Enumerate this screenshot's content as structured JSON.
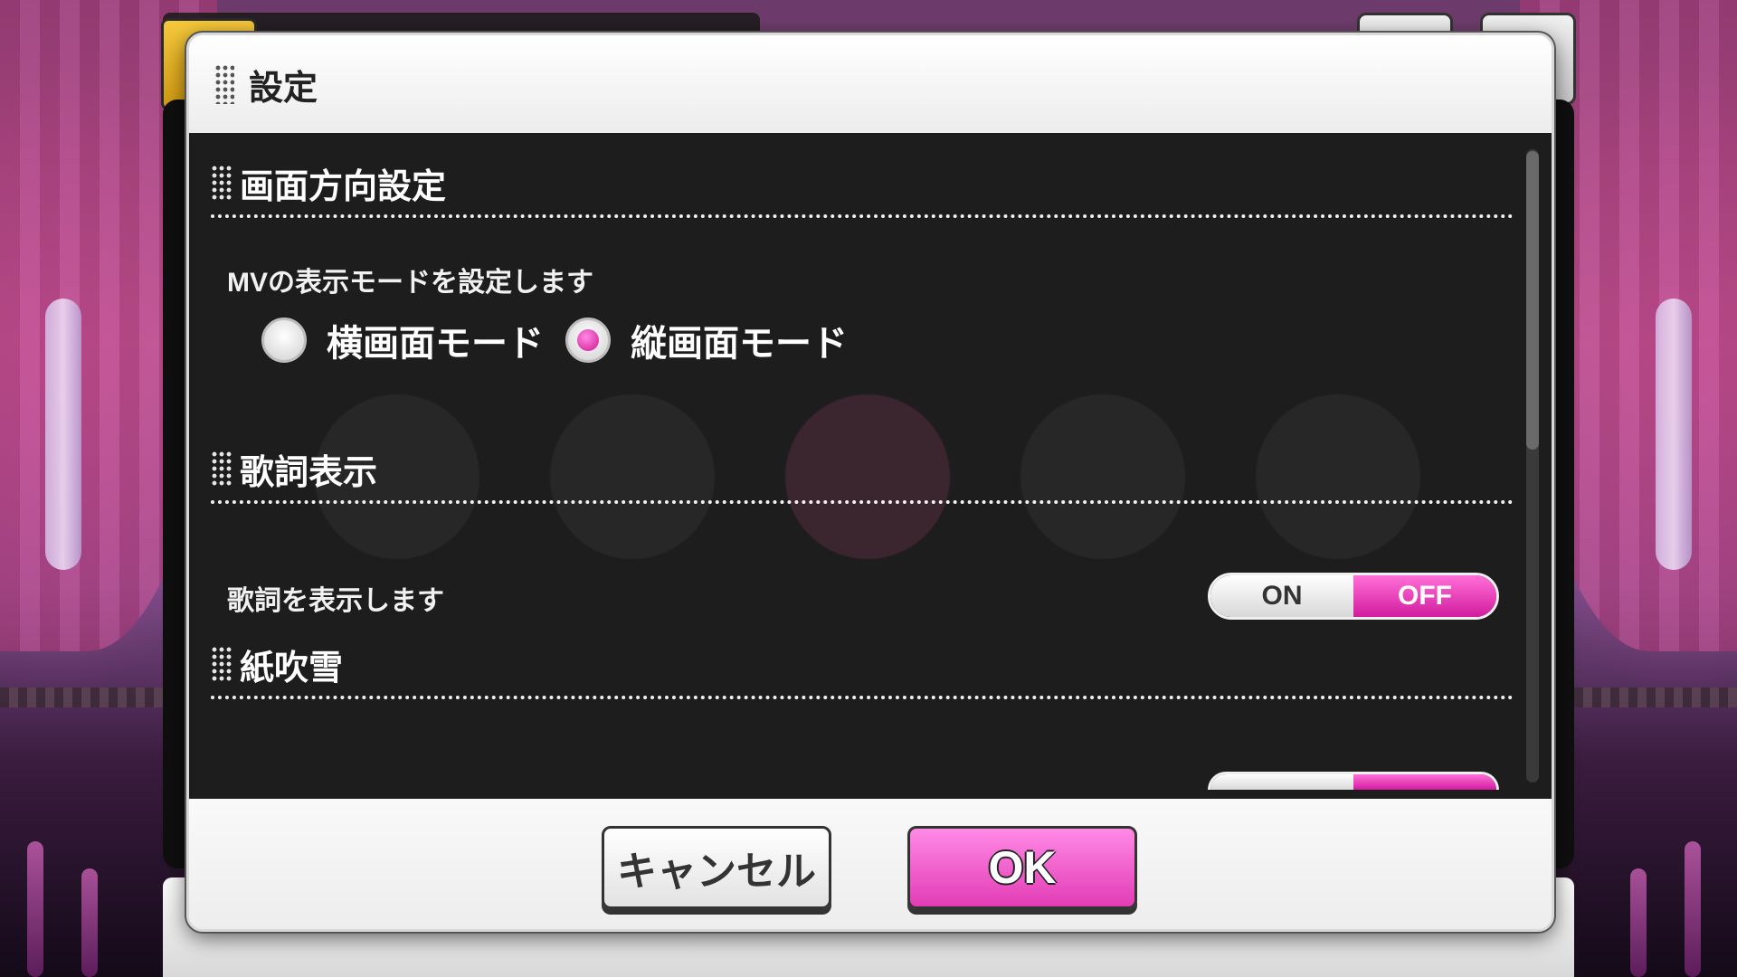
{
  "dialog": {
    "title": "設定"
  },
  "sections": {
    "orientation": {
      "title": "画面方向設定",
      "description": "MVの表示モードを設定します",
      "options": [
        {
          "label": "横画面モード",
          "selected": false
        },
        {
          "label": "縦画面モード",
          "selected": true
        }
      ]
    },
    "lyrics": {
      "title": "歌詞表示",
      "description": "歌詞を表示します",
      "toggle": {
        "on_label": "ON",
        "off_label": "OFF",
        "value": "OFF"
      }
    },
    "confetti": {
      "title": "紙吹雪"
    }
  },
  "buttons": {
    "cancel": "キャンセル",
    "ok": "OK"
  },
  "colors": {
    "accent": "#e23cb5",
    "body_bg": "#0f0f0f",
    "dialog_bg": "#ffffff"
  }
}
